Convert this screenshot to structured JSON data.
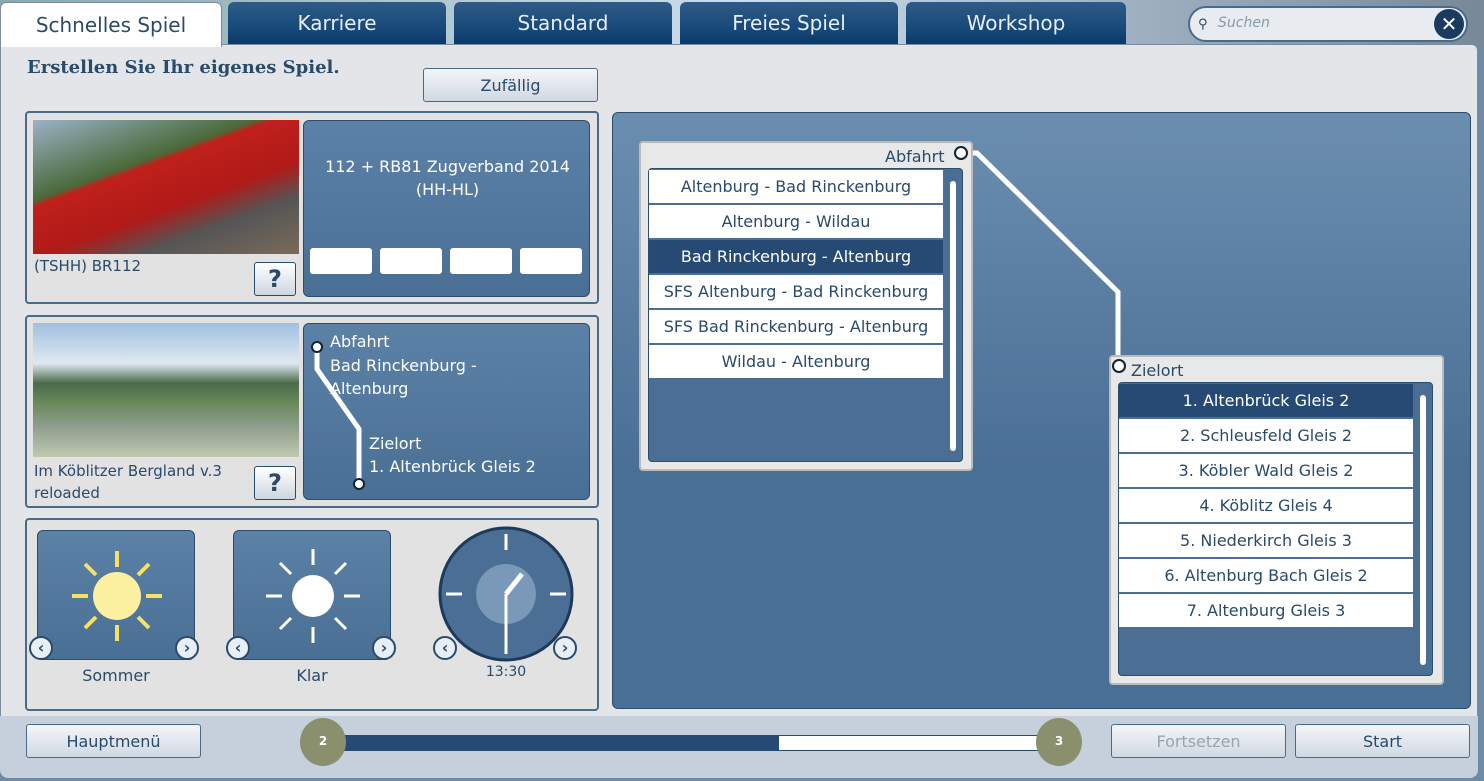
{
  "tabs": [
    "Schnelles Spiel",
    "Karriere",
    "Standard",
    "Freies Spiel",
    "Workshop"
  ],
  "search": {
    "placeholder": "Suchen"
  },
  "title": "Erstellen Sie Ihr eigenes Spiel.",
  "random_button": "Zufällig",
  "train": {
    "name": "(TSHH) BR112",
    "consist": "112 + RB81 Zugverband 2014 (HH-HL)",
    "help": "?"
  },
  "route": {
    "name": "Im Köblitzer Bergland v.3 reloaded",
    "help": "?",
    "departure_label": "Abfahrt",
    "departure": "Bad Rinckenburg - Altenburg",
    "destination_label": "Zielort",
    "destination": "1. Altenbrück Gleis 2"
  },
  "conditions": {
    "season": "Sommer",
    "weather": "Klar",
    "time": "13:30"
  },
  "departures": {
    "label": "Abfahrt",
    "items": [
      "Altenburg - Bad Rinckenburg",
      "Altenburg - Wildau",
      "Bad Rinckenburg - Altenburg",
      "SFS Altenburg - Bad Rinckenburg",
      "SFS Bad Rinckenburg - Altenburg",
      "Wildau - Altenburg"
    ],
    "selected": 2
  },
  "destinations": {
    "label": "Zielort",
    "items": [
      "1. Altenbrück Gleis 2",
      "2. Schleusfeld Gleis 2",
      "3. Köbler Wald Gleis 2",
      "4. Köblitz Gleis 4",
      "5. Niederkirch Gleis 3",
      "6. Altenburg Bach Gleis 2",
      "7. Altenburg Gleis 3"
    ],
    "selected": 0
  },
  "footer": {
    "main_menu": "Hauptmenü",
    "continue": "Fortsetzen",
    "start": "Start",
    "step_from": "2",
    "step_to": "3",
    "progress": 0.63
  }
}
